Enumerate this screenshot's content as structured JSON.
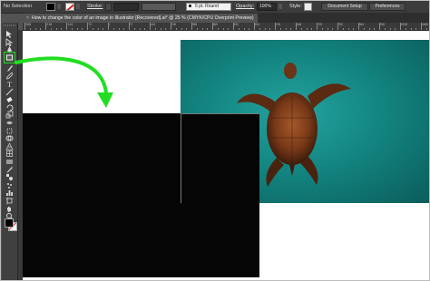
{
  "control_bar": {
    "selection_status": "No Selection",
    "stroke_label": "Stroke:",
    "brush_label": "5 pt. Round",
    "opacity_label": "Opacity:",
    "opacity_value": "100%",
    "style_label": "Style:",
    "document_setup_label": "Document Setup",
    "preferences_label": "Preferences"
  },
  "document_tab": {
    "close_glyph": "×",
    "title": "How to change the color of an image in Illustrator [Recovered].ai* @ 25 % (CMYK/CPU Overprint Preview)"
  },
  "ruler": {
    "labels": [
      "-288",
      "-216",
      "-144",
      "-72",
      "0",
      "72",
      "144",
      "216",
      "288",
      "360",
      "432",
      "504",
      "576",
      "648",
      "720",
      "792",
      "864",
      "936",
      "1008",
      "1080"
    ]
  },
  "toolbar": {
    "active_tool": "rectangle-tool",
    "tools": [
      "selection-tool",
      "direct-selection-tool",
      "pen-tool",
      "rectangle-tool",
      "paintbrush-tool",
      "pencil-tool",
      "type-tool",
      "line-tool",
      "eraser-tool",
      "rotate-tool",
      "scale-tool",
      "width-tool",
      "free-transform-tool",
      "shape-builder-tool",
      "perspective-grid-tool",
      "mesh-tool",
      "gradient-tool",
      "eyedropper-tool",
      "blend-tool",
      "symbol-sprayer-tool",
      "column-graph-tool",
      "artboard-tool",
      "hand-tool",
      "zoom-tool"
    ]
  },
  "colors": {
    "highlight": "#22dd22",
    "fill": "#000000",
    "stroke": "none",
    "canvas_rect": "#050506",
    "photo_water": "#138581"
  },
  "canvas": {
    "photo_subject": "sea-turtle-photo"
  }
}
